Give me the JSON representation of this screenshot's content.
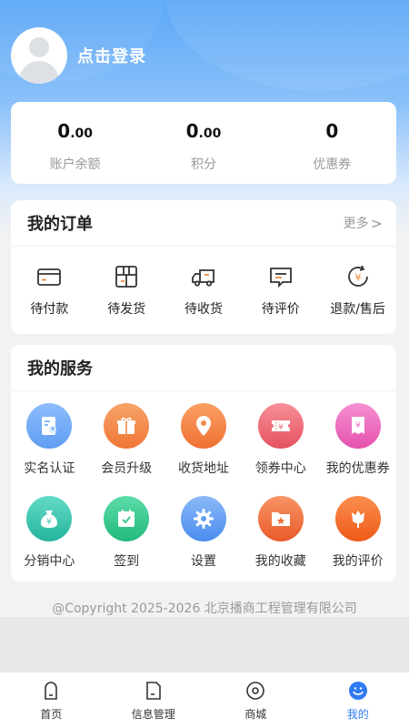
{
  "header": {
    "login_text": "点击登录"
  },
  "stats": [
    {
      "value_int": "0",
      "value_dec": ".00",
      "label": "账户余额"
    },
    {
      "value_int": "0",
      "value_dec": ".00",
      "label": "积分"
    },
    {
      "value_int": "0",
      "value_dec": "",
      "label": "优惠券"
    }
  ],
  "orders": {
    "title": "我的订单",
    "more": "更多",
    "items": [
      {
        "label": "待付款",
        "icon": "card-icon"
      },
      {
        "label": "待发货",
        "icon": "box-icon"
      },
      {
        "label": "待收货",
        "icon": "truck-icon"
      },
      {
        "label": "待评价",
        "icon": "comment-icon"
      },
      {
        "label": "退款/售后",
        "icon": "refund-icon"
      }
    ]
  },
  "services": {
    "title": "我的服务",
    "items": [
      {
        "label": "实名认证",
        "icon": "id-card-icon",
        "color": "#6aa8f7"
      },
      {
        "label": "会员升级",
        "icon": "gift-icon",
        "color": "#f38a4c"
      },
      {
        "label": "收货地址",
        "icon": "location-pin-icon",
        "color": "#f58a48"
      },
      {
        "label": "领券中心",
        "icon": "coupon-center-icon",
        "color": "#ef6f7c"
      },
      {
        "label": "我的优惠券",
        "icon": "my-coupon-icon",
        "color": "#ee6fc0"
      },
      {
        "label": "分销中心",
        "icon": "money-bag-icon",
        "color": "#3ec7b0"
      },
      {
        "label": "签到",
        "icon": "calendar-check-icon",
        "color": "#37c98f"
      },
      {
        "label": "设置",
        "icon": "gear-icon",
        "color": "#5f9ef4"
      },
      {
        "label": "我的收藏",
        "icon": "favorite-folder-icon",
        "color": "#f1733f"
      },
      {
        "label": "我的评价",
        "icon": "tulip-icon",
        "color": "#f36d2e"
      }
    ]
  },
  "copyright": "@Copyright 2025-2026 北京播商工程管理有限公司",
  "tabbar": [
    {
      "label": "首页",
      "icon": "home-icon",
      "active": false
    },
    {
      "label": "信息管理",
      "icon": "document-icon",
      "active": false
    },
    {
      "label": "商城",
      "icon": "mall-icon",
      "active": false
    },
    {
      "label": "我的",
      "icon": "profile-icon",
      "active": true
    }
  ],
  "colors": {
    "primary": "#2f7bf2",
    "muted": "#9a9a9a",
    "page_bg": "#f2f2f2"
  }
}
